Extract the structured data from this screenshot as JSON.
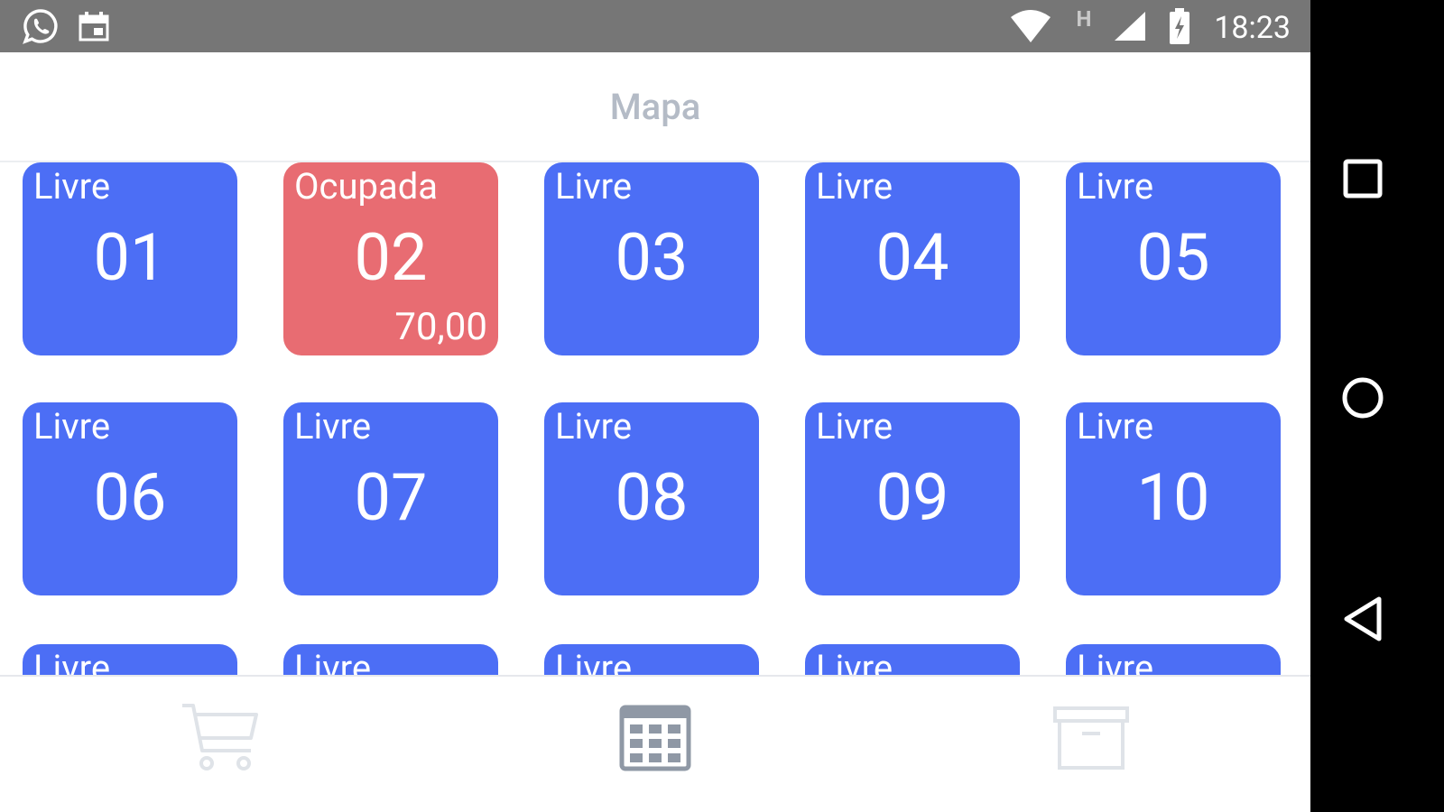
{
  "status_bar": {
    "time": "18:23",
    "network_letter": "H",
    "left_icons": [
      "whatsapp-icon",
      "calendar-icon"
    ],
    "right_icons": [
      "wifi-icon",
      "network-h-icon",
      "signal-icon",
      "battery-charging-icon"
    ]
  },
  "header": {
    "title": "Mapa"
  },
  "tables": [
    {
      "status": "Livre",
      "number": "01",
      "amount": "",
      "state": "free"
    },
    {
      "status": "Ocupada",
      "number": "02",
      "amount": "70,00",
      "state": "occupied"
    },
    {
      "status": "Livre",
      "number": "03",
      "amount": "",
      "state": "free"
    },
    {
      "status": "Livre",
      "number": "04",
      "amount": "",
      "state": "free"
    },
    {
      "status": "Livre",
      "number": "05",
      "amount": "",
      "state": "free"
    },
    {
      "status": "Livre",
      "number": "06",
      "amount": "",
      "state": "free"
    },
    {
      "status": "Livre",
      "number": "07",
      "amount": "",
      "state": "free"
    },
    {
      "status": "Livre",
      "number": "08",
      "amount": "",
      "state": "free"
    },
    {
      "status": "Livre",
      "number": "09",
      "amount": "",
      "state": "free"
    },
    {
      "status": "Livre",
      "number": "10",
      "amount": "",
      "state": "free"
    },
    {
      "status": "Livre",
      "number": "",
      "amount": "",
      "state": "free"
    },
    {
      "status": "Livre",
      "number": "",
      "amount": "",
      "state": "free"
    },
    {
      "status": "Livre",
      "number": "",
      "amount": "",
      "state": "free"
    },
    {
      "status": "Livre",
      "number": "",
      "amount": "",
      "state": "free"
    },
    {
      "status": "Livre",
      "number": "",
      "amount": "",
      "state": "free"
    }
  ],
  "bottom_nav": [
    "cart-icon",
    "table-map-icon",
    "archive-icon"
  ],
  "system_nav": [
    "recents-icon",
    "home-icon",
    "back-icon"
  ],
  "colors": {
    "free": "#4c6ef5",
    "occupied": "#e86c72",
    "status_bar": "#767676",
    "title": "#b4bbc6",
    "nav_icon_active": "#8f98a5",
    "nav_icon_inactive": "#dfe3e8"
  }
}
